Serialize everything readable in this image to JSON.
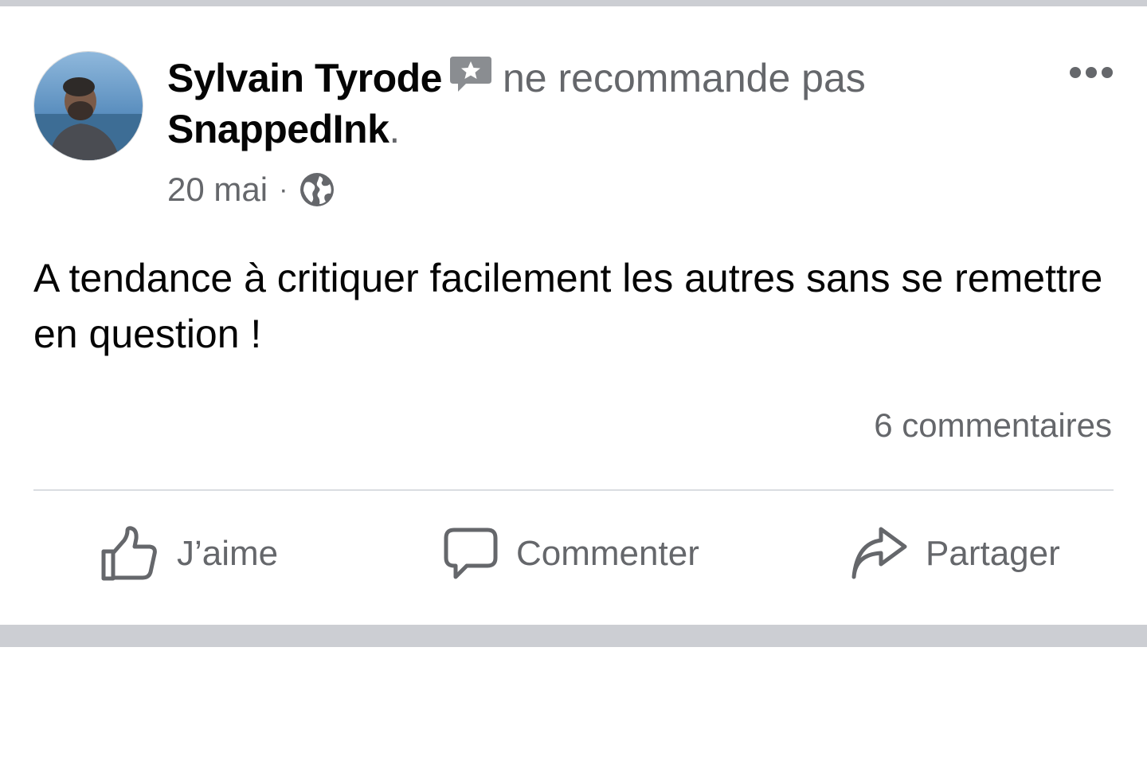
{
  "post": {
    "author_name": "Sylvain Tyrode",
    "review_verb": "ne recommande pas",
    "page_name": "SnappedInk",
    "page_name_suffix": ".",
    "date": "20 mai",
    "meta_separator": "·",
    "privacy_icon": "globe-icon",
    "review_icon": "review-star-bubble-icon",
    "more_icon": "more-dots-icon",
    "body": "A tendance à critiquer facilement les autres sans se remettre en question !",
    "comments_count_label": "6 commentaires"
  },
  "actions": {
    "like_label": "J’aime",
    "comment_label": "Commenter",
    "share_label": "Partager"
  },
  "colors": {
    "primary_text": "#050505",
    "secondary_text": "#65676b",
    "separator_bar": "#ccced3",
    "divider": "#dadde1"
  }
}
